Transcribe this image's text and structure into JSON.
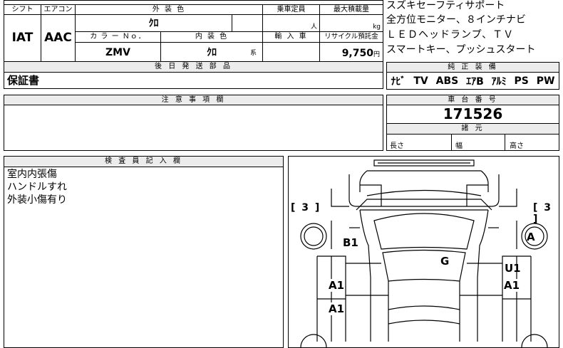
{
  "top_row": {
    "shift_label": "シフト",
    "aircon_label": "エアコン",
    "exterior_color_label": "外 装 色",
    "capacity_label": "乗車定員",
    "max_load_label": "最大積載量",
    "shift_value": "IAT",
    "aircon_value": "AAC",
    "exterior_color_value": "ｸﾛ",
    "capacity_unit": "人",
    "load_unit": "kg",
    "color_no_label": "カ ラ ー Ｎｏ．",
    "interior_color_label": "内 装 色",
    "import_label": "輸 入 車",
    "recycle_label": "リサイクル預託金",
    "color_no_value": "ZMV",
    "interior_color_value": "ｸﾛ",
    "interior_suffix": "系",
    "recycle_value": "9,750",
    "recycle_unit": "円"
  },
  "features_text": [
    "スズキセーフティサポート",
    "全方位モニター、８インチナビ",
    "ＬＥＤヘッドランプ、ＴＶ",
    "スマートキー、プッシュスタート"
  ],
  "later_parts": {
    "label": "後 日 発 送 部 品",
    "value": "保証書"
  },
  "genuine": {
    "label": "純 正 装 備",
    "items": [
      "ﾅﾋﾞ",
      "TV",
      "ABS",
      "ｴｱB",
      "ｱﾙﾐ",
      "PS",
      "PW"
    ]
  },
  "notes": {
    "label": "注 意 事 項 欄"
  },
  "chassis": {
    "label": "車 台 番 号",
    "value": "171526"
  },
  "specs": {
    "label": "諸 元",
    "length_label": "長さ",
    "width_label": "幅",
    "height_label": "高さ"
  },
  "inspector": {
    "label": "検 査 員 記 入 欄",
    "lines": [
      "室内内張傷",
      "ハンドルすれ",
      "外装小傷有り"
    ]
  },
  "diagram": {
    "left_bracket": "[ 3 ]",
    "right_bracket": "[ 3 ]",
    "marks": {
      "a": "A",
      "b1": "B1",
      "g": "G",
      "u1": "U1",
      "a1_left_1": "A1",
      "a1_right": "A1",
      "a1_left_2": "A1"
    }
  }
}
